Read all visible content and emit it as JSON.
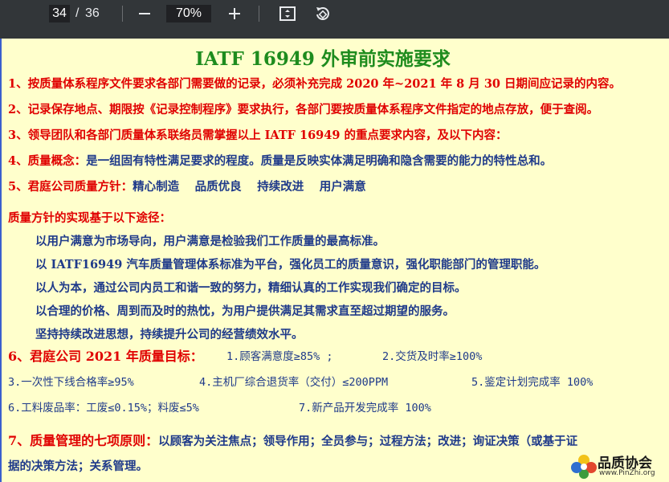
{
  "toolbar": {
    "page_current": "34",
    "page_separator": "/",
    "page_total": "36",
    "zoom": "70%",
    "icons": [
      "zoom-out-icon",
      "zoom-in-icon",
      "fit-page-icon",
      "rotate-icon"
    ]
  },
  "doc": {
    "title": "IATF 16949 外审前实施要求",
    "items": [
      "1、按质量体系程序文件要求各部门需要做的记录，必须补充完成 2020 年~2021 年 8 月 30 日期间应记录的内容。",
      "2、记录保存地点、期限按《记录控制程序》要求执行，各部门要按质量体系程序文件指定的地点存放，便于查阅。",
      "3、领导团队和各部门质量体系联络员需掌握以上 IATF 16949 的重点要求内容，及以下内容："
    ],
    "item4_label": "4、质量概念：",
    "item4_text": "是一组固有特性满足要求的程度。质量是反映实体满足明确和隐含需要的能力的特性总和。",
    "item5_label": "5、君庭公司质量方针：",
    "item5_text": "精心制造　 品质优良　 持续改进　 用户满意",
    "policy_heading": "质量方针的实现基于以下途径：",
    "policy_points": [
      "以用户满意为市场导向，用户满意是检验我们工作质量的最高标准。",
      "以 IATF16949 汽车质量管理体系标准为平台，强化员工的质量意识，强化职能部门的管理职能。",
      "以人为本，通过公司内员工和谐一致的努力，精细认真的工作实现我们确定的目标。",
      "以合理的价格、周到而及时的热忱，为用户提供满足其需求直至超过期望的服务。",
      "坚持持续改进思想，持续提升公司的经营绩效水平。"
    ],
    "item6_label": "6、君庭公司 2021 年质量目标：",
    "goals": [
      "1.顾客满意度≥85% ;",
      "2.交货及时率≥100%",
      "3.一次性下线合格率≥95%",
      "4.主机厂综合退货率（交付）≤200PPM",
      "5.鉴定计划完成率 100%",
      "6.工料废品率：工废≤0.15%；料废≤5%",
      "7.新产品开发完成率 100%"
    ],
    "item7_label": "7、质量管理的七项原则：",
    "item7_text": "以顾客为关注焦点；领导作用；全员参与；过程方法；改进；询证决策（或基于证",
    "item7_text_cont": "据的决策方法；关系管理。"
  },
  "watermark": {
    "name": "品质协会",
    "url": "www.PinZhi.org"
  },
  "colors": {
    "page_bg": "#ffffcc",
    "title": "#1e8c1e",
    "red": "#e00000",
    "blue": "#1f3a8a",
    "toolbar_bg": "#323639"
  }
}
